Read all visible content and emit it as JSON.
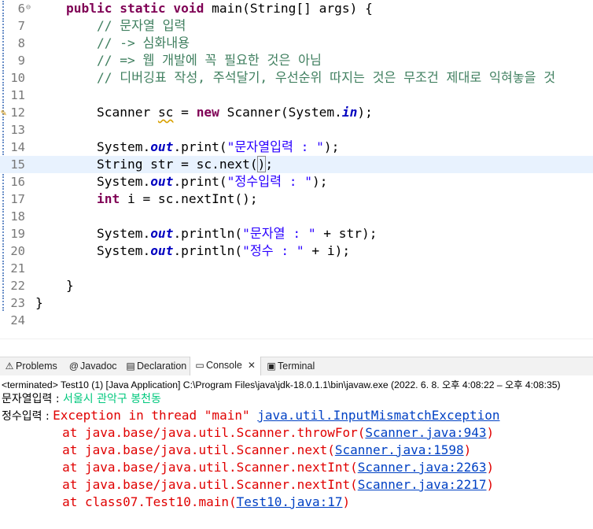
{
  "editor": {
    "lines": [
      {
        "n": "6",
        "tokens": [
          [
            "kw",
            "    public static void "
          ],
          [
            "var",
            "main(String[] args) {"
          ]
        ]
      },
      {
        "n": "7",
        "tokens": [
          [
            "cmt",
            "        // 문자열 입력"
          ]
        ]
      },
      {
        "n": "8",
        "tokens": [
          [
            "cmt",
            "        // -> 심화내용"
          ]
        ]
      },
      {
        "n": "9",
        "tokens": [
          [
            "cmt",
            "        // => 웹 개발에 꼭 필요한 것은 아님"
          ]
        ]
      },
      {
        "n": "10",
        "tokens": [
          [
            "cmt",
            "        // 디버깅표 작성, 주석달기, 우선순위 따지는 것은 무조건 제대로 익혀놓을 것"
          ]
        ]
      },
      {
        "n": "11",
        "tokens": []
      },
      {
        "n": "12",
        "tokens": [
          [
            "var",
            "        Scanner "
          ],
          [
            "warn",
            "sc"
          ],
          [
            "var",
            " = "
          ],
          [
            "kw",
            "new"
          ],
          [
            "var",
            " Scanner(System."
          ],
          [
            "fld",
            "in"
          ],
          [
            "var",
            ");"
          ]
        ]
      },
      {
        "n": "13",
        "tokens": []
      },
      {
        "n": "14",
        "tokens": [
          [
            "var",
            "        System."
          ],
          [
            "fld",
            "out"
          ],
          [
            "var",
            ".print("
          ],
          [
            "str",
            "\"문자열입력 : \""
          ],
          [
            "var",
            ");"
          ]
        ]
      },
      {
        "n": "15",
        "tokens": [
          [
            "var",
            "        String str = sc.next("
          ],
          [
            "caret",
            ")"
          ],
          [
            "var",
            ";"
          ]
        ]
      },
      {
        "n": "16",
        "tokens": [
          [
            "var",
            "        System."
          ],
          [
            "fld",
            "out"
          ],
          [
            "var",
            ".print("
          ],
          [
            "str",
            "\"정수입력 : \""
          ],
          [
            "var",
            ");"
          ]
        ]
      },
      {
        "n": "17",
        "tokens": [
          [
            "kw",
            "        int"
          ],
          [
            "var",
            " i = sc.nextInt();"
          ]
        ]
      },
      {
        "n": "18",
        "tokens": []
      },
      {
        "n": "19",
        "tokens": [
          [
            "var",
            "        System."
          ],
          [
            "fld",
            "out"
          ],
          [
            "var",
            ".println("
          ],
          [
            "str",
            "\"문자열 : \""
          ],
          [
            "var",
            " + str);"
          ]
        ]
      },
      {
        "n": "20",
        "tokens": [
          [
            "var",
            "        System."
          ],
          [
            "fld",
            "out"
          ],
          [
            "var",
            ".println("
          ],
          [
            "str",
            "\"정수 : \""
          ],
          [
            "var",
            " + i);"
          ]
        ]
      },
      {
        "n": "21",
        "tokens": []
      },
      {
        "n": "22",
        "tokens": [
          [
            "var",
            "    }"
          ]
        ]
      },
      {
        "n": "23",
        "tokens": [
          [
            "var",
            "}"
          ]
        ]
      },
      {
        "n": "24",
        "tokens": []
      }
    ],
    "current_line": "15",
    "warning_line": "12",
    "fold_line": "6",
    "fold_glyph": "⊖",
    "warning_glyph": "✎",
    "hscroll_left_glyph": "<"
  },
  "tabs": [
    {
      "name": "problems",
      "icon": "⚠",
      "label": "Problems",
      "active": false
    },
    {
      "name": "javadoc",
      "icon": "@",
      "label": "Javadoc",
      "active": false
    },
    {
      "name": "declaration",
      "icon": "▤",
      "label": "Declaration",
      "active": false
    },
    {
      "name": "console",
      "icon": "▭",
      "label": "Console",
      "active": true,
      "close": "✕"
    },
    {
      "name": "terminal",
      "icon": "▣",
      "label": "Terminal",
      "active": false
    }
  ],
  "console": {
    "terminated": "<terminated> Test10 (1) [Java Application] C:\\Program Files\\java\\jdk-18.0.1.1\\bin\\javaw.exe  (2022. 6. 8. 오후 4:08:22 – 오후 4:08:35)",
    "lines": [
      [
        [
          "out",
          "문자열입력 : "
        ],
        [
          "in",
          "서울시 관악구 봉천동"
        ]
      ],
      [
        [
          "out",
          "정수입력 : "
        ],
        [
          "err",
          "Exception in thread \"main\" "
        ],
        [
          "link",
          "java.util.InputMismatchException"
        ]
      ],
      [
        [
          "err",
          "        at java.base/java.util.Scanner.throwFor("
        ],
        [
          "link",
          "Scanner.java:943"
        ],
        [
          "err",
          ")"
        ]
      ],
      [
        [
          "err",
          "        at java.base/java.util.Scanner.next("
        ],
        [
          "link",
          "Scanner.java:1598"
        ],
        [
          "err",
          ")"
        ]
      ],
      [
        [
          "err",
          "        at java.base/java.util.Scanner.nextInt("
        ],
        [
          "link",
          "Scanner.java:2263"
        ],
        [
          "err",
          ")"
        ]
      ],
      [
        [
          "err",
          "        at java.base/java.util.Scanner.nextInt("
        ],
        [
          "link",
          "Scanner.java:2217"
        ],
        [
          "err",
          ")"
        ]
      ],
      [
        [
          "err",
          "        at class07.Test10.main("
        ],
        [
          "link",
          "Test10.java:17"
        ],
        [
          "err",
          ")"
        ]
      ]
    ]
  },
  "colors": {
    "keyword": "#7f0055",
    "comment": "#3f7f5f",
    "string": "#2a00ff",
    "field": "#0000c0",
    "current_line": "#e8f2fe",
    "console_error": "#e00000",
    "console_input": "#00c87d",
    "link": "#0041c4"
  }
}
